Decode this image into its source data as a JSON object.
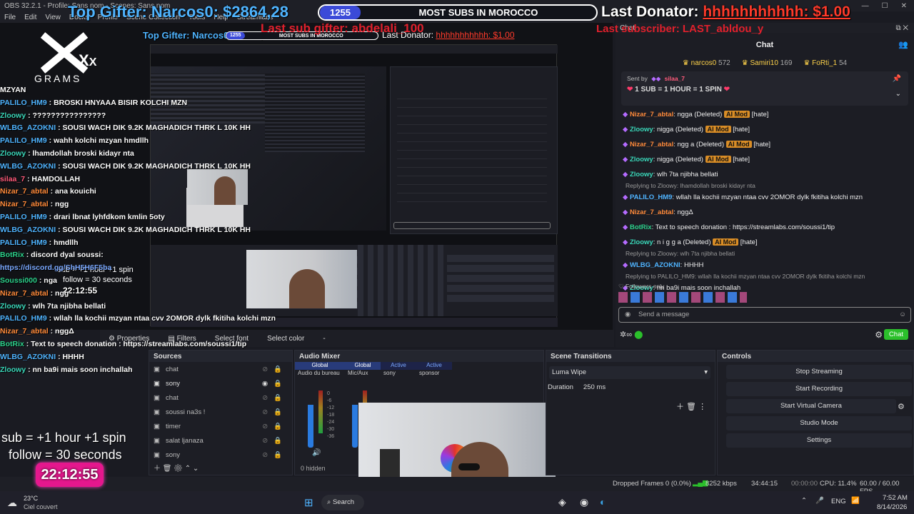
{
  "window": {
    "title": "OBS 32.2.1 - Profile: Sans nom - Scenes: Sans nom"
  },
  "menu": [
    "File",
    "Edit",
    "View",
    "Docks",
    "Profile",
    "Scene Collection",
    "Tools",
    "Help",
    "Streamlabs"
  ],
  "overlay": {
    "top_gifter": "Top Gifter: Narcos0: $2864,28",
    "sub_count": "1255",
    "sub_goal": "MOST SUBS IN MOROCCO",
    "last_donator_label": "Last Donator:",
    "last_donator_value": "hhhhhhhhhhh: $1.00",
    "last_sub_gifter": "Last sub gifter: abdelali_100",
    "last_subscriber": "Last subscriber: LAST_abldou_y",
    "logo_text": "GRAMS",
    "sub_rule": "sub  = +1 hour +1 spin",
    "follow_rule": "follow = 30 seconds",
    "timer": "22:12:55",
    "nested_timer": "22:12:55",
    "nested_sub_rule": "sub = +1 hour +1 spin",
    "nested_follow_rule": "follow = 30 seconds"
  },
  "left_chat": [
    {
      "user": "",
      "text": "MZYAN",
      "color": "#ffffff"
    },
    {
      "user": "PALILO_HM9",
      "text": " : BROSKI HNYAAA BISIR KOLCHI MZN",
      "color": "#4fb4ff"
    },
    {
      "user": "Zloowy",
      "text": " : ????????????????",
      "color": "#3ad7b9"
    },
    {
      "user": "WLBG_AZOKNI",
      "text": " : SOUSI WACH DIK 9.2K MAGHADICH THRK L 10K HH",
      "color": "#4fb4ff"
    },
    {
      "user": "PALILO_HM9",
      "text": " : wahh kolchi mzyan hmdllh",
      "color": "#4fb4ff"
    },
    {
      "user": "Zloowy",
      "text": " : lhamdollah broski kidayr nta",
      "color": "#3ad7b9"
    },
    {
      "user": "WLBG_AZOKNI",
      "text": " : SOUSI WACH DIK 9.2K MAGHADICH THRK L 10K HH",
      "color": "#4fb4ff"
    },
    {
      "user": "silaa_7",
      "text": " : HAMDOLLAH",
      "color": "#ff5a7a"
    },
    {
      "user": "Nizar_7_abtal",
      "text": " : ana kouichi",
      "color": "#ff8a3a"
    },
    {
      "user": "Nizar_7_abtal",
      "text": " : ngg",
      "color": "#ff8a3a"
    },
    {
      "user": "PALILO_HM9",
      "text": " : drari lbnat lyhfdkom kmlin 5oty",
      "color": "#4fb4ff"
    },
    {
      "user": "WLBG_AZOKNI",
      "text": " : SOUSI WACH DIK 9.2K MAGHADICH THRK L 10K HH",
      "color": "#4fb4ff"
    },
    {
      "user": "PALILO_HM9",
      "text": " : hmdllh",
      "color": "#4fb4ff"
    },
    {
      "user": "BotRix",
      "text": " : discord dyal soussi:",
      "color": "#2bd08a"
    },
    {
      "user": "",
      "text": "https://discord.gg/ShH5H6F5ba",
      "color": "#7aa8ff"
    },
    {
      "user": "Soussi000",
      "text": " : nga",
      "color": "#2bd08a"
    },
    {
      "user": "Nizar_7_abtal",
      "text": " : ngg",
      "color": "#ff8a3a"
    },
    {
      "user": "Zloowy",
      "text": " : wlh 7ta njibha bellati",
      "color": "#3ad7b9"
    },
    {
      "user": "PALILO_HM9",
      "text": " : wllah lla kochii mzyan ntaa cvv 2OMOR dylk fkitiha kolchi mzn",
      "color": "#4fb4ff"
    },
    {
      "user": "Nizar_7_abtal",
      "text": " : nggΔ",
      "color": "#ff8a3a"
    },
    {
      "user": "BotRix",
      "text": " : Text to speech donation : https://streamlabs.com/soussi1/tip",
      "color": "#2bd08a"
    },
    {
      "user": "WLBG_AZOKNI",
      "text": " : HHHH",
      "color": "#4fb4ff"
    },
    {
      "user": "Zloowy",
      "text": " : nn ba9i mais soon inchallah",
      "color": "#3ad7b9"
    }
  ],
  "chat": {
    "dock_title": "Chat",
    "title": "Chat",
    "leaders": [
      {
        "name": "narcos0",
        "count": "572"
      },
      {
        "name": "Samiri10",
        "count": "169"
      },
      {
        "name": "FoRti_1",
        "count": "54"
      }
    ],
    "pinned_by_label": "Sent by",
    "pinned_by": "silaa_7",
    "pinned_text": "1 SUB = 1 HOUR = 1 SPIN",
    "partial_top": "Zloowy: nigga (Deleted) AI Mod",
    "messages": [
      {
        "reply": "",
        "user": "Nizar_7_abtal",
        "text": "ngga (Deleted)",
        "tag": "AI Mod",
        "after": "[hate]",
        "color": "#ff8a3a"
      },
      {
        "reply": "",
        "user": "Zloowy",
        "text": "nigga (Deleted)",
        "tag": "AI Mod",
        "after": "[hate]",
        "color": "#3ad7b9"
      },
      {
        "reply": "",
        "user": "Nizar_7_abtal",
        "text": "ngg a (Deleted)",
        "tag": "AI Mod",
        "after": "[hate]",
        "color": "#ff8a3a"
      },
      {
        "reply": "",
        "user": "Zloowy",
        "text": "nigga (Deleted)",
        "tag": "AI Mod",
        "after": "[hate]",
        "color": "#3ad7b9"
      },
      {
        "reply": "",
        "user": "Zloowy",
        "text": "wlh 7ta njibha bellati",
        "tag": "",
        "after": "",
        "color": "#3ad7b9"
      },
      {
        "reply": "Replying to Zloowy: lhamdollah broski kidayr nta",
        "user": "PALILO_HM9",
        "text": "wllah lla kochii mzyan ntaa cvv 2OMOR dylk fkitiha kolchi mzn",
        "tag": "",
        "after": "",
        "color": "#4fb4ff"
      },
      {
        "reply": "",
        "user": "Nizar_7_abtal",
        "text": "nggΔ",
        "tag": "",
        "after": "",
        "color": "#ff8a3a"
      },
      {
        "reply": "",
        "user": "BotRix",
        "text": "Text to speech donation : https://streamlabs.com/soussi1/tip",
        "tag": "",
        "after": "",
        "color": "#2bd08a"
      },
      {
        "reply": "",
        "user": "Zloowy",
        "text": "n i g g a (Deleted)",
        "tag": "AI Mod",
        "after": "[hate]",
        "color": "#3ad7b9"
      },
      {
        "reply": "Replying to Zloowy: wlh 7ta njibha bellati",
        "user": "WLBG_AZOKNI",
        "text": "HHHH",
        "tag": "",
        "after": "",
        "color": "#4fb4ff"
      },
      {
        "reply": "Replying to PALILO_HM9: wllah lla kochii mzyan ntaa cvv 2OMOR dylk fkitiha kolchi mzn",
        "user": "Zloowy",
        "text": "nn ba9i mais soon inchallah",
        "tag": "",
        "after": "",
        "color": "#3ad7b9"
      }
    ],
    "followers_only": "Followers only",
    "placeholder": "Send a message",
    "send_label": "Chat"
  },
  "context_bar": {
    "properties": "Properties",
    "filters": "Filters",
    "select_font": "Select font",
    "select_color": "Select color",
    "dash": "-"
  },
  "sources": {
    "title": "Sources",
    "items": [
      {
        "name": "chat",
        "visible": false
      },
      {
        "name": "sony",
        "visible": true
      },
      {
        "name": "chat",
        "visible": false
      },
      {
        "name": "soussi na3s !",
        "visible": false
      },
      {
        "name": "timer",
        "visible": false
      },
      {
        "name": "salat ljanaza",
        "visible": false
      },
      {
        "name": "sony",
        "visible": false
      }
    ]
  },
  "mixer": {
    "title": "Audio Mixer",
    "tabs": [
      "Global",
      "Global",
      "Active",
      "Active"
    ],
    "channels": [
      "Audio du bureau",
      "Mic/Aux",
      "sony",
      "sponsor"
    ],
    "db": [
      "0",
      "-6",
      "-12",
      "-18",
      "-24",
      "-30",
      "-36"
    ],
    "hidden": "0 hidden"
  },
  "transitions": {
    "title": "Scene Transitions",
    "selected": "Luma Wipe",
    "duration_label": "Duration",
    "duration": "250 ms"
  },
  "controls": {
    "title": "Controls",
    "buttons": [
      "Stop Streaming",
      "Start Recording",
      "Start Virtual Camera",
      "Studio Mode",
      "Settings"
    ]
  },
  "status": {
    "dropped": "Dropped Frames 0 (0.0%)",
    "kbps": "8252 kbps",
    "live_time": "34:44:15",
    "rec_time": "00:00:00",
    "cpu": "CPU: 11.4%",
    "fps": "60.00 / 60.00 FPS"
  },
  "taskbar": {
    "temp": "23°C",
    "weather": "Ciel couvert",
    "search": "Search",
    "lang": "ENG",
    "time": "7:52 AM",
    "date": "8/14/2026"
  },
  "colors": {
    "accent": "#2bc02b",
    "bg": "#1a1b22",
    "panel": "#1d1e25"
  }
}
